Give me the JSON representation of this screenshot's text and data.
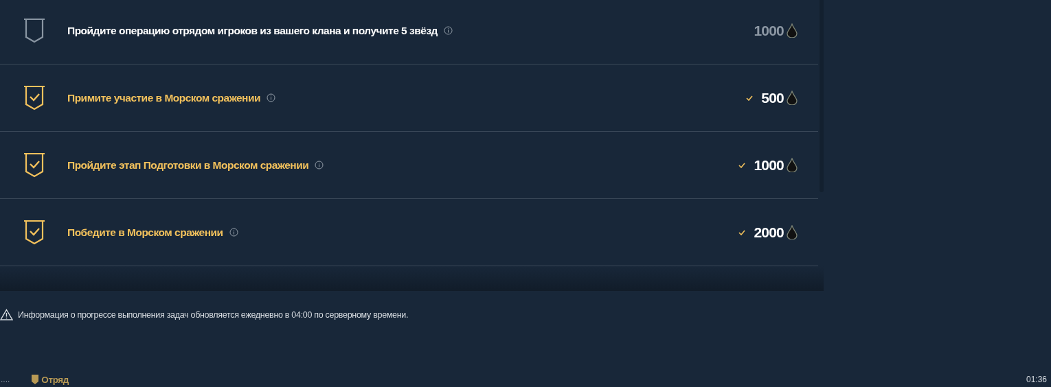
{
  "tasks": [
    {
      "title": "Пройдите операцию отрядом игроков из вашего клана и получите 5 звёзд",
      "completed": false,
      "reward": "1000"
    },
    {
      "title": "Примите участие в Морском сражении",
      "completed": true,
      "reward": "500"
    },
    {
      "title": "Пройдите этап Подготовки в Морском сражении",
      "completed": true,
      "reward": "1000"
    },
    {
      "title": "Победите в Морском сражении",
      "completed": true,
      "reward": "2000"
    }
  ],
  "notice": "Информация о прогрессе выполнения задач обновляется ежедневно в 04:00 по серверному времени.",
  "status_bar": {
    "dots": "....",
    "squad": "Отряд",
    "time": "01:36"
  }
}
